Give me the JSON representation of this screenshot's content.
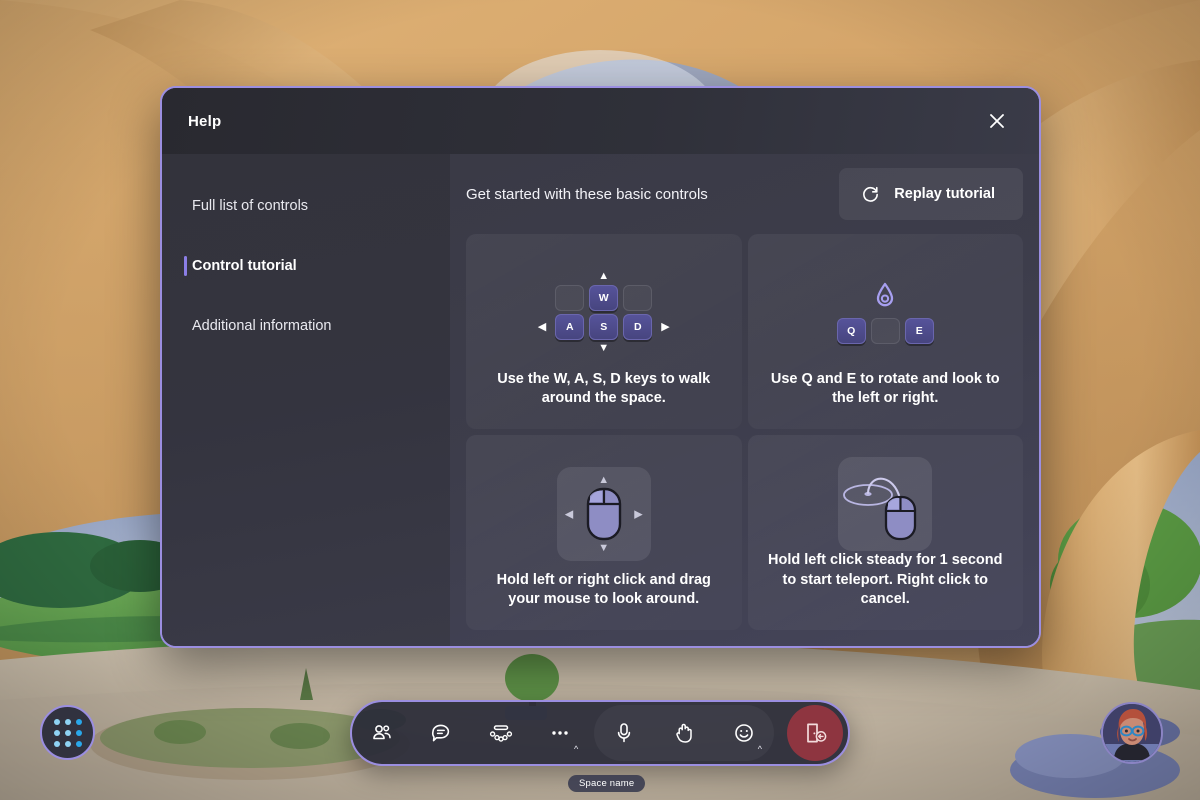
{
  "dialog": {
    "title": "Help",
    "close_icon": "close-icon",
    "nav": [
      {
        "label": "Full list of controls",
        "active": false
      },
      {
        "label": "Control tutorial",
        "active": true
      },
      {
        "label": "Additional information",
        "active": false
      }
    ],
    "main_title": "Get started with these basic controls",
    "replay_button": {
      "label": "Replay tutorial",
      "icon": "replay-refresh-icon"
    },
    "cards": [
      {
        "id": "wasd",
        "caption": "Use the W, A, S, D keys to walk around the space.",
        "keys_top": [
          "",
          "W",
          ""
        ],
        "keys_mid": [
          "A",
          "S",
          "D"
        ],
        "arrows": [
          "up",
          "left",
          "right",
          "down"
        ]
      },
      {
        "id": "qe",
        "caption": "Use Q and E to rotate and look to the left or right.",
        "icon": "rotate-teardrop-icon",
        "keys": [
          "Q",
          "",
          "E"
        ]
      },
      {
        "id": "look",
        "caption": "Hold left or right click and drag your mouse to look around.",
        "icon": "mouse-drag-icon",
        "arrows": [
          "up",
          "left",
          "right",
          "down"
        ]
      },
      {
        "id": "teleport",
        "caption": "Hold left click steady for 1 second to start teleport. Right click to cancel.",
        "icon": "mouse-teleport-icon"
      }
    ]
  },
  "toolbar": {
    "buttons": [
      {
        "name": "people-icon",
        "label": "People",
        "chevron": false
      },
      {
        "name": "chat-icon",
        "label": "Chat",
        "chevron": false
      },
      {
        "name": "take-a-seat-icon",
        "label": "Take a seat",
        "chevron": false
      },
      {
        "name": "more-options-icon",
        "label": "More",
        "chevron": true
      },
      {
        "name": "microphone-icon",
        "label": "Mic",
        "chevron": false
      },
      {
        "name": "raise-hand-icon",
        "label": "Raise hand",
        "chevron": false
      },
      {
        "name": "reactions-emoji-icon",
        "label": "Reactions",
        "chevron": true
      }
    ],
    "leave": {
      "name": "leave-door-icon",
      "label": "Leave"
    }
  },
  "overlays": {
    "apps_button": {
      "name": "app-grid-icon",
      "label": "Apps"
    },
    "avatar": {
      "name": "user-avatar",
      "label": "Avatar"
    },
    "space_name": "Space name"
  },
  "colors": {
    "accent_border": "#9b8ee0",
    "key_purple": "#56539a",
    "leave_red": "#8e3540",
    "dot_blue_light": "#7fc9f2",
    "dot_blue": "#2aa8ea"
  }
}
